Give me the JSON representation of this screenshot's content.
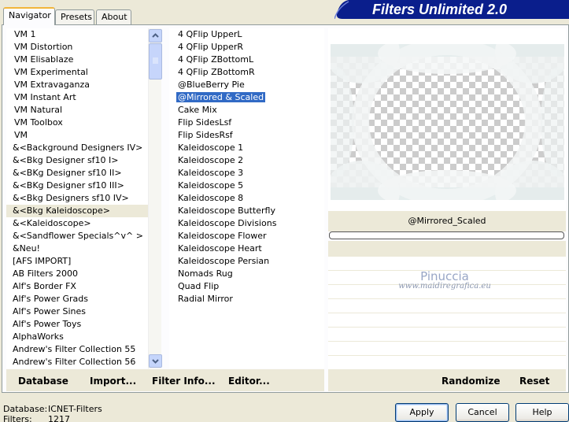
{
  "app": {
    "title": "Filters Unlimited 2.0"
  },
  "tabs": [
    {
      "label": "Navigator",
      "active": true
    },
    {
      "label": "Presets",
      "active": false
    },
    {
      "label": "About",
      "active": false
    }
  ],
  "categories": [
    "VM 1",
    "VM Distortion",
    "VM Elisablaze",
    "VM Experimental",
    "VM Extravaganza",
    "VM Instant Art",
    "VM Natural",
    "VM Toolbox",
    "VM",
    "&<Background Designers IV>",
    "&<Bkg Designer sf10 I>",
    "&<BKg Designer sf10 II>",
    "&<BKg Designer sf10 III>",
    "&<Bkg Designers sf10 IV>",
    "&<Bkg Kaleidoscope>",
    "&<Kaleidoscope>",
    "&<Sandflower Specials^v^ >",
    "&Neu!",
    "[AFS IMPORT]",
    "AB Filters 2000",
    "Alf's Border FX",
    "Alf's Power Grads",
    "Alf's Power Sines",
    "Alf's Power Toys",
    "AlphaWorks",
    "Andrew's Filter Collection 55",
    "Andrew's Filter Collection 56"
  ],
  "selected_category": "&<Bkg Kaleidoscope>",
  "filters": [
    "4 QFlip UpperL",
    "4 QFlip UpperR",
    "4 QFlip ZBottomL",
    "4 QFlip ZBottomR",
    "@BlueBerry Pie",
    "@Mirrored & Scaled",
    "Cake Mix",
    "Flip SidesLsf",
    "Flip SidesRsf",
    "Kaleidoscope 1",
    "Kaleidoscope 2",
    "Kaleidoscope 3",
    "Kaleidoscope 5",
    "Kaleidoscope 8",
    "Kaleidoscope Butterfly",
    "Kaleidoscope Divisions",
    "Kaleidoscope Flower",
    "Kaleidoscope Heart",
    "Kaleidoscope Persian",
    "Nomads Rug",
    "Quad Flip",
    "Radial Mirror"
  ],
  "selected_filter": "@Mirrored & Scaled",
  "preview": {
    "filter_name": "@Mirrored_Scaled",
    "accent_color": "#8fb3b3"
  },
  "watermark": {
    "name": "Pinuccia",
    "url": "www.maidiregrafica.eu"
  },
  "toolbar": {
    "database": "Database",
    "import": "Import...",
    "filter_info": "Filter Info...",
    "editor": "Editor...",
    "randomize": "Randomize",
    "reset": "Reset"
  },
  "status": {
    "database_label": "Database:",
    "database_value": "ICNET-Filters",
    "filters_label": "Filters:",
    "filters_value": "1217"
  },
  "buttons": {
    "apply": "Apply",
    "cancel": "Cancel",
    "help": "Help"
  }
}
